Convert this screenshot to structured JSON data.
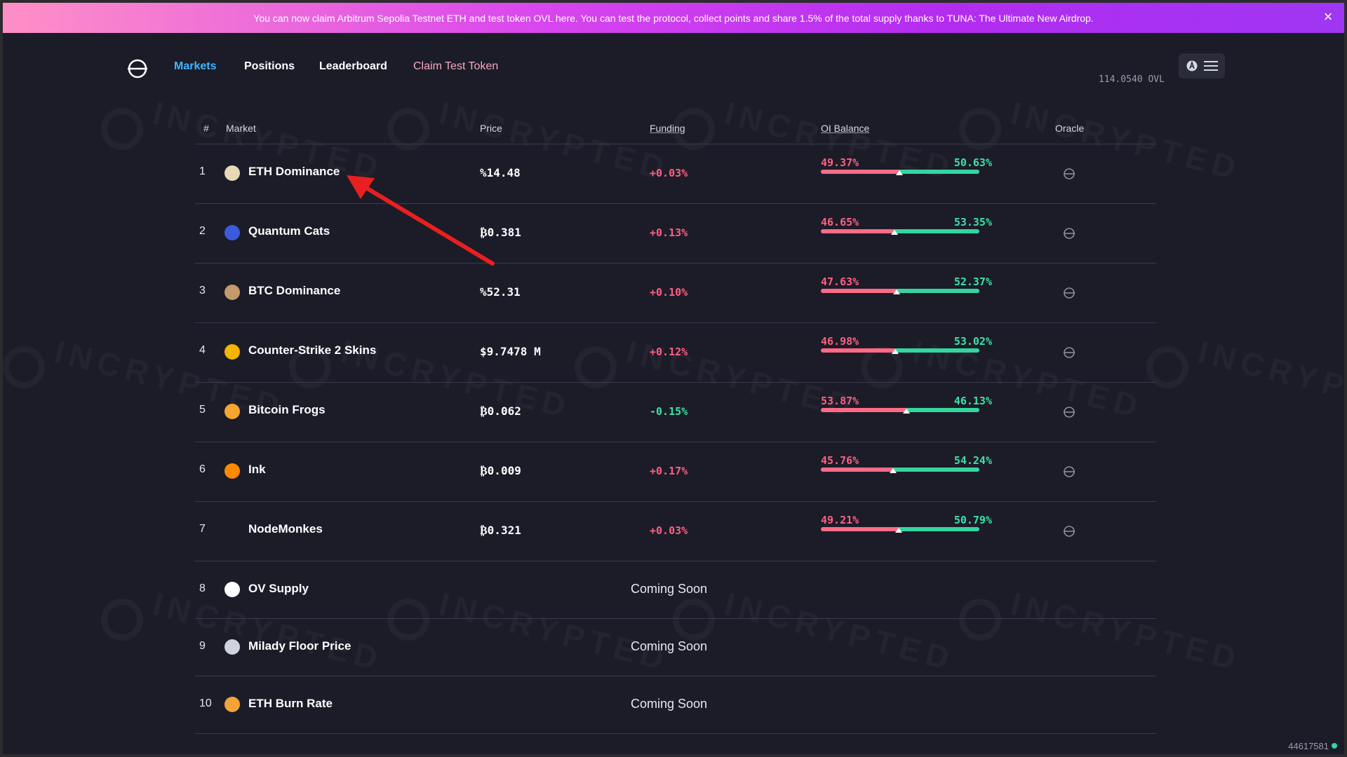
{
  "banner": {
    "text": "You can now claim Arbitrum Sepolia Testnet ETH and test token OVL here. You can test the protocol, collect points and share 1.5% of the total supply thanks to TUNA: The Ultimate New Airdrop.",
    "close_icon": "close-icon"
  },
  "nav": {
    "markets": "Markets",
    "positions": "Positions",
    "leaderboard": "Leaderboard",
    "claim": "Claim Test Token"
  },
  "account": {
    "balance": "114.0540 OVL"
  },
  "table": {
    "headers": {
      "num": "#",
      "market": "Market",
      "price": "Price",
      "funding": "Funding",
      "oi": "OI Balance",
      "oracle": "Oracle"
    },
    "rows": [
      {
        "num": "1",
        "name": "ETH Dominance",
        "price": "%14.48",
        "funding": "+0.03%",
        "oi_short": "49.37%",
        "oi_long": "50.63%",
        "short_frac": 0.4937
      },
      {
        "num": "2",
        "name": "Quantum Cats",
        "price": "₿0.381",
        "funding": "+0.13%",
        "oi_short": "46.65%",
        "oi_long": "53.35%",
        "short_frac": 0.4665
      },
      {
        "num": "3",
        "name": "BTC Dominance",
        "price": "%52.31",
        "funding": "+0.10%",
        "oi_short": "47.63%",
        "oi_long": "52.37%",
        "short_frac": 0.4763
      },
      {
        "num": "4",
        "name": "Counter-Strike 2 Skins",
        "price": "$9.7478 M",
        "funding": "+0.12%",
        "oi_short": "46.98%",
        "oi_long": "53.02%",
        "short_frac": 0.4698
      },
      {
        "num": "5",
        "name": "Bitcoin Frogs",
        "price": "₿0.062",
        "funding": "-0.15%",
        "oi_short": "53.87%",
        "oi_long": "46.13%",
        "short_frac": 0.5387
      },
      {
        "num": "6",
        "name": "Ink",
        "price": "₿0.009",
        "funding": "+0.17%",
        "oi_short": "45.76%",
        "oi_long": "54.24%",
        "short_frac": 0.4576
      },
      {
        "num": "7",
        "name": "NodeMonkes",
        "price": "₿0.321",
        "funding": "+0.03%",
        "oi_short": "49.21%",
        "oi_long": "50.79%",
        "short_frac": 0.4921
      }
    ],
    "coming": [
      {
        "num": "8",
        "name": "OV Supply",
        "status": "Coming Soon"
      },
      {
        "num": "9",
        "name": "Milady Floor Price",
        "status": "Coming Soon"
      },
      {
        "num": "10",
        "name": "ETH Burn Rate",
        "status": "Coming Soon"
      }
    ]
  },
  "colors": {
    "accent": "#3fb6ff",
    "positive": "#ff5f82",
    "negative": "#3ee0a6",
    "claim": "#f9a8c0"
  },
  "watermark": "INCRYPTED",
  "footer": {
    "id": "44617581"
  }
}
